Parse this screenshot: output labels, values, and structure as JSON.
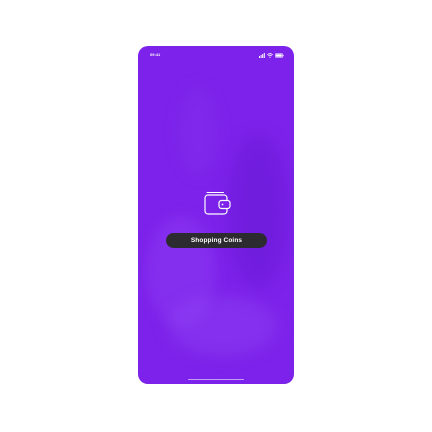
{
  "status_bar": {
    "time": "09:41",
    "icons": [
      "signal-icon",
      "wifi-icon",
      "battery-icon"
    ]
  },
  "splash": {
    "icon": "wallet-icon",
    "label": "Shopping Coins"
  },
  "colors": {
    "background": "#7c22ea",
    "chip_background": "#2c2c30",
    "text": "#ffffff"
  }
}
